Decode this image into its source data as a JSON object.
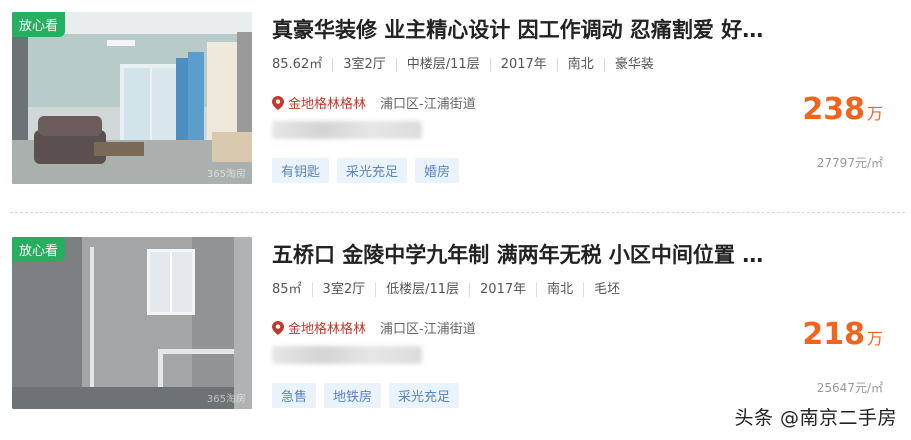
{
  "listings": [
    {
      "badge": "放心看",
      "watermark": "365淘房",
      "title": "真豪华装修 业主精心设计 因工作调动 忍痛割爱 好…",
      "attrs": [
        "85.62㎡",
        "3室2厅",
        "中楼层/11层",
        "2017年",
        "南北",
        "豪华装"
      ],
      "community": "金地格林格林",
      "district": "浦口区-江浦街道",
      "tags": [
        "有钥匙",
        "采光充足",
        "婚房"
      ],
      "price": "238",
      "price_unit": "万",
      "unit_price": "27797元/㎡"
    },
    {
      "badge": "放心看",
      "watermark": "365淘房",
      "title": "五桥口 金陵中学九年制 满两年无税 小区中间位置 …",
      "attrs": [
        "85㎡",
        "3室2厅",
        "低楼层/11层",
        "2017年",
        "南北",
        "毛坯"
      ],
      "community": "金地格林格林",
      "district": "浦口区-江浦街道",
      "tags": [
        "急售",
        "地铁房",
        "采光充足"
      ],
      "price": "218",
      "price_unit": "万",
      "unit_price": "25647元/㎡"
    }
  ],
  "footer_watermark": "头条 @南京二手房",
  "colors": {
    "badge": "#27ae60",
    "price": "#f0641e",
    "community": "#c0392b",
    "tag_bg": "#eaf2fb",
    "tag_text": "#5b86b8"
  }
}
